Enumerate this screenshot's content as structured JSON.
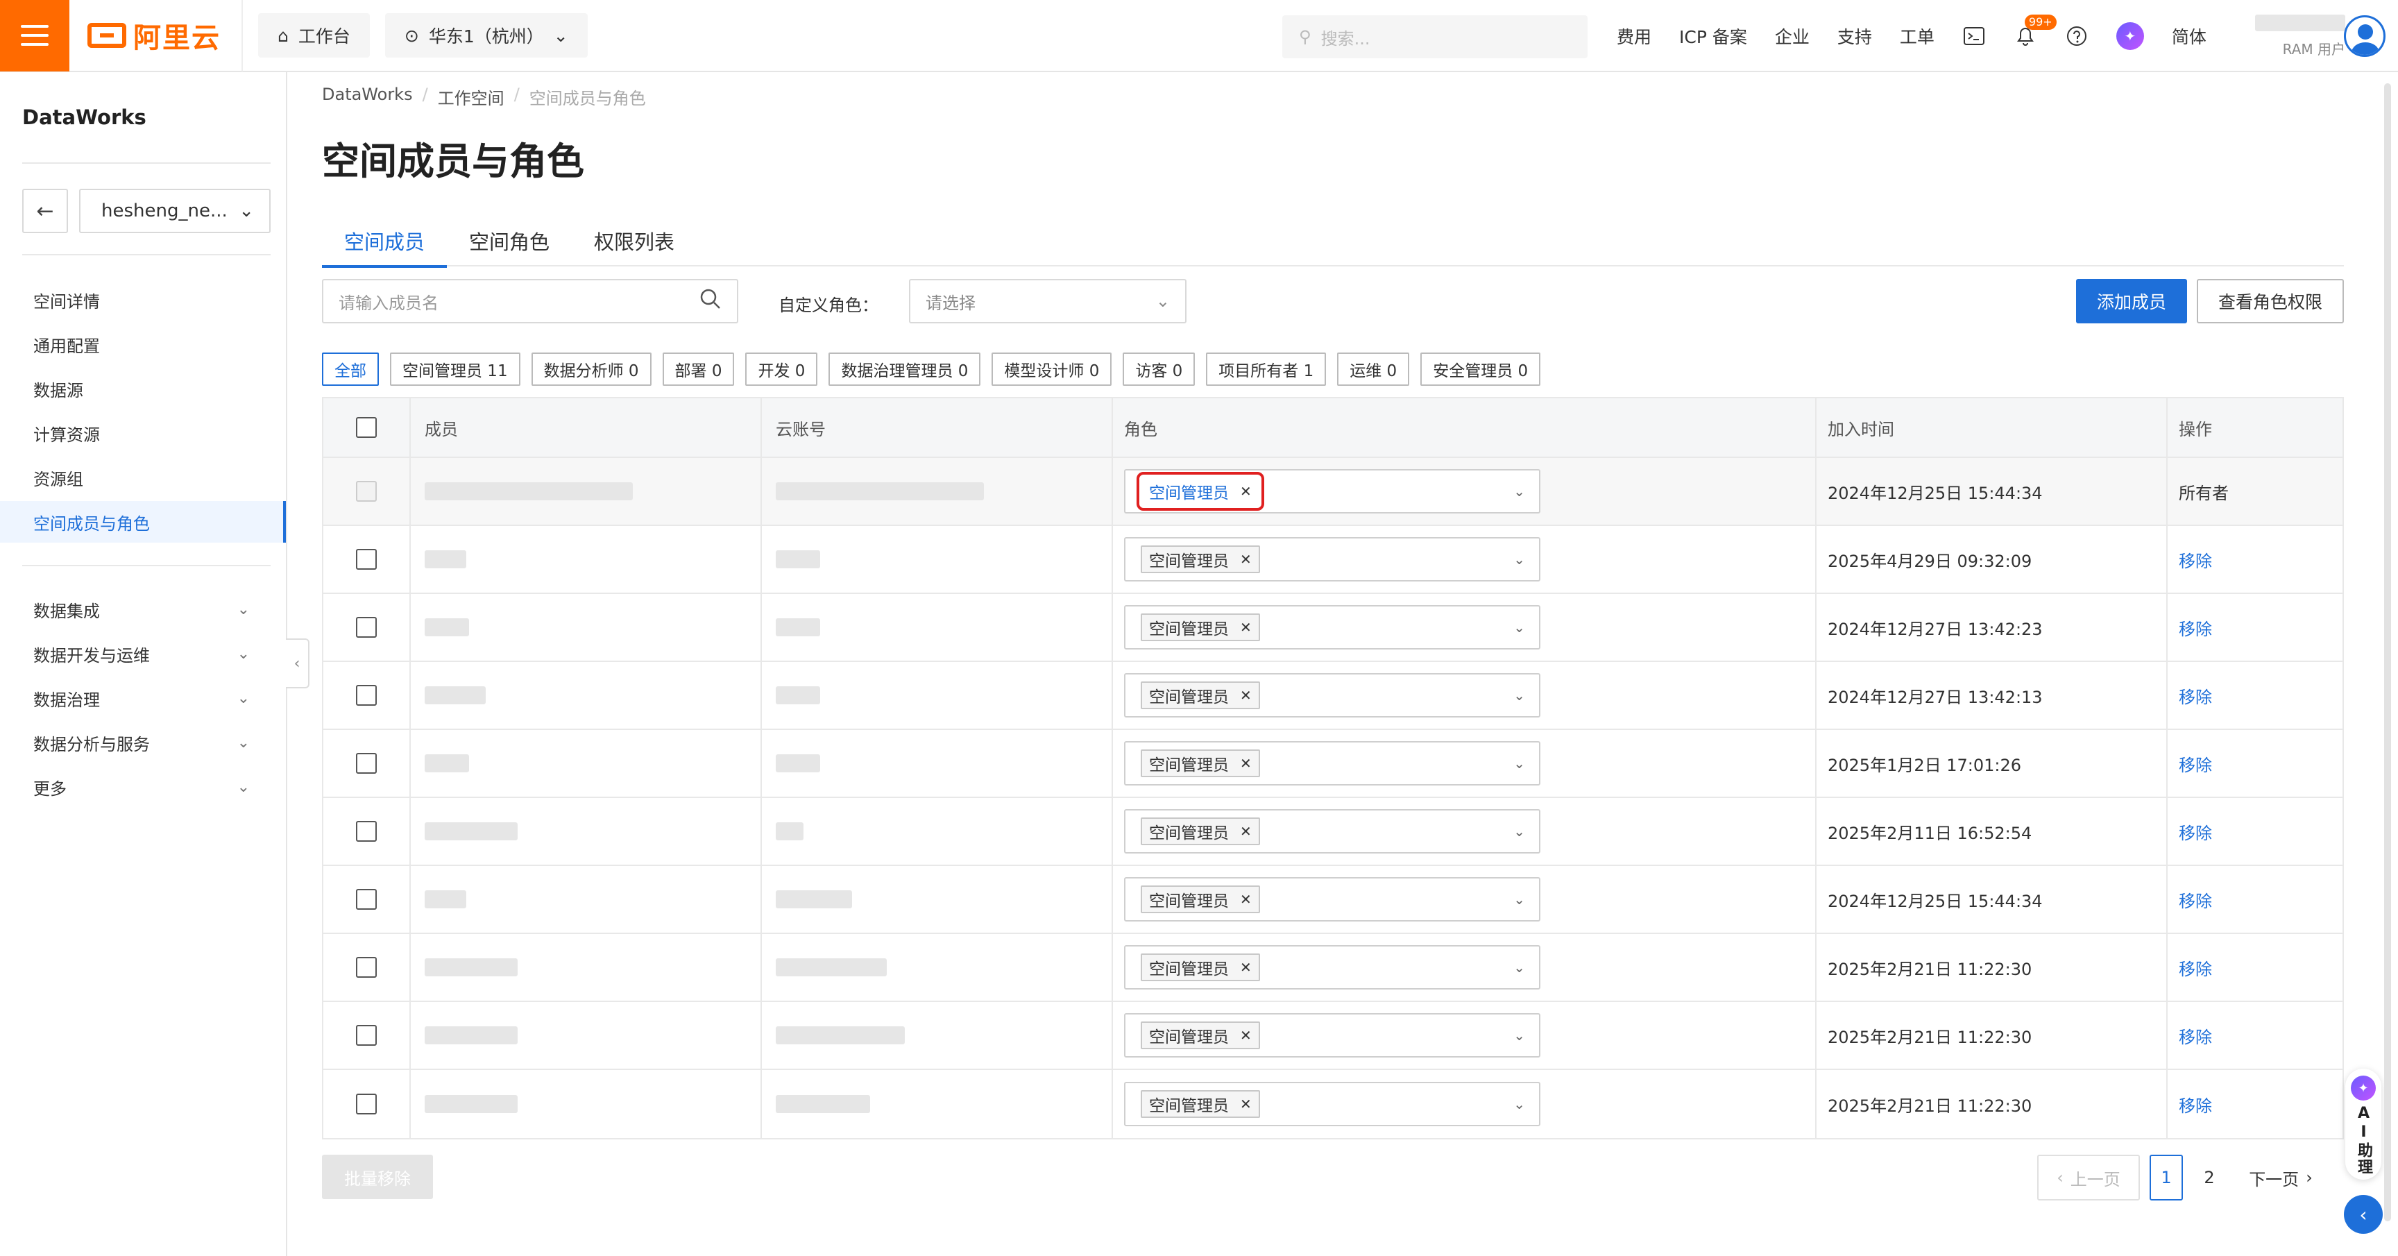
{
  "topbar": {
    "logo_text": "阿里云",
    "workbench": "工作台",
    "region": "华东1（杭州）",
    "search_placeholder": "搜索...",
    "links": [
      "费用",
      "ICP 备案",
      "企业",
      "支持",
      "工单"
    ],
    "notification_badge": "99+",
    "language": "简体",
    "user_type": "RAM 用户"
  },
  "sidebar": {
    "title": "DataWorks",
    "workspace": "hesheng_ne...",
    "items": [
      {
        "label": "空间详情",
        "active": false
      },
      {
        "label": "通用配置",
        "active": false
      },
      {
        "label": "数据源",
        "active": false
      },
      {
        "label": "计算资源",
        "active": false
      },
      {
        "label": "资源组",
        "active": false
      },
      {
        "label": "空间成员与角色",
        "active": true
      }
    ],
    "groups": [
      "数据集成",
      "数据开发与运维",
      "数据治理",
      "数据分析与服务",
      "更多"
    ]
  },
  "breadcrumb": [
    "DataWorks",
    "工作空间",
    "空间成员与角色"
  ],
  "page_title": "空间成员与角色",
  "tabs": [
    {
      "label": "空间成员",
      "active": true
    },
    {
      "label": "空间角色",
      "active": false
    },
    {
      "label": "权限列表",
      "active": false
    }
  ],
  "toolbar": {
    "search_placeholder": "请输入成员名",
    "role_label": "自定义角色：",
    "role_placeholder": "请选择",
    "add_member": "添加成员",
    "view_permissions": "查看角色权限"
  },
  "filters": [
    {
      "label": "全部",
      "active": true
    },
    {
      "label": "空间管理员 11",
      "active": false
    },
    {
      "label": "数据分析师 0",
      "active": false
    },
    {
      "label": "部署 0",
      "active": false
    },
    {
      "label": "开发 0",
      "active": false
    },
    {
      "label": "数据治理管理员 0",
      "active": false
    },
    {
      "label": "模型设计师 0",
      "active": false
    },
    {
      "label": "访客 0",
      "active": false
    },
    {
      "label": "项目所有者 1",
      "active": false
    },
    {
      "label": "运维 0",
      "active": false
    },
    {
      "label": "安全管理员 0",
      "active": false
    }
  ],
  "table": {
    "headers": {
      "member": "成员",
      "account": "云账号",
      "role": "角色",
      "join_time": "加入时间",
      "op": "操作"
    },
    "rows": [
      {
        "role": "空间管理员",
        "time": "2024年12月25日 15:44:34",
        "op": "所有者"
      },
      {
        "role": "空间管理员",
        "time": "2025年4月29日 09:32:09",
        "op": "移除"
      },
      {
        "role": "空间管理员",
        "time": "2024年12月27日 13:42:23",
        "op": "移除"
      },
      {
        "role": "空间管理员",
        "time": "2024年12月27日 13:42:13",
        "op": "移除"
      },
      {
        "role": "空间管理员",
        "time": "2025年1月2日 17:01:26",
        "op": "移除"
      },
      {
        "role": "空间管理员",
        "time": "2025年2月11日 16:52:54",
        "op": "移除"
      },
      {
        "role": "空间管理员",
        "time": "2024年12月25日 15:44:34",
        "op": "移除"
      },
      {
        "role": "空间管理员",
        "time": "2025年2月21日 11:22:30",
        "op": "移除"
      },
      {
        "role": "空间管理员",
        "time": "2025年2月21日 11:22:30",
        "op": "移除"
      },
      {
        "role": "空间管理员",
        "time": "2025年2月21日 11:22:30",
        "op": "移除"
      }
    ]
  },
  "footer": {
    "batch_remove": "批量移除",
    "prev": "上一页",
    "pages": [
      "1",
      "2"
    ],
    "next": "下一页"
  },
  "ai_assistant": "AI助理",
  "colors": {
    "brand": "#ff6a00",
    "primary": "#1e6fd9",
    "highlight": "#e02020"
  }
}
